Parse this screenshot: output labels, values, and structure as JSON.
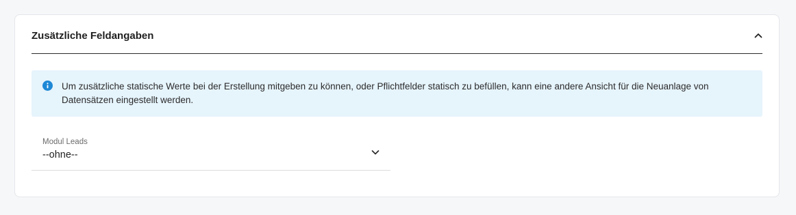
{
  "section": {
    "title": "Zusätzliche Feldangaben",
    "collapse_icon": "chevron-up-icon"
  },
  "info": {
    "icon": "info-icon",
    "text": "Um zusätzliche statische Werte bei der Erstellung mitgeben zu können, oder Pflichtfelder statisch zu befüllen, kann eine andere Ansicht für die Neuanlage von Datensätzen eingestellt werden."
  },
  "module_select": {
    "label": "Modul Leads",
    "value": "--ohne--",
    "icon": "chevron-down-icon"
  },
  "colors": {
    "info_background": "#e6f4fc",
    "info_icon": "#1e88d6",
    "page_background": "#f6f7f9"
  }
}
